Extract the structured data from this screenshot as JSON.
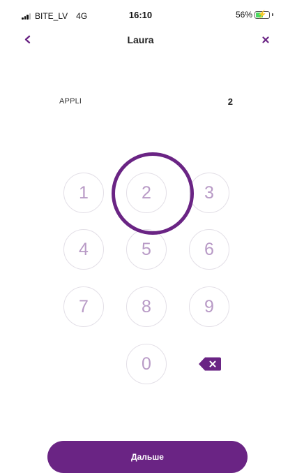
{
  "status_bar": {
    "carrier": "BITE_LV",
    "network": "4G",
    "time": "16:10",
    "battery": "56%",
    "battery_level": 0.56,
    "signal_icon": "cellular-signal-icon",
    "battery_icon": "battery-charging-icon"
  },
  "nav": {
    "title": "Laura",
    "back_icon": "chevron-left-icon",
    "close_icon": "close-icon"
  },
  "entry": {
    "label": "APPLI",
    "value": "2"
  },
  "keypad": {
    "keys": [
      "1",
      "2",
      "3",
      "4",
      "5",
      "6",
      "7",
      "8",
      "9",
      "0"
    ],
    "highlighted_key": "2",
    "backspace_icon": "backspace-icon"
  },
  "footer": {
    "next_label": "Дальше"
  },
  "colors": {
    "brand": "#6a2484",
    "key_text": "#b89ac6",
    "key_border": "#e3dfe7"
  }
}
